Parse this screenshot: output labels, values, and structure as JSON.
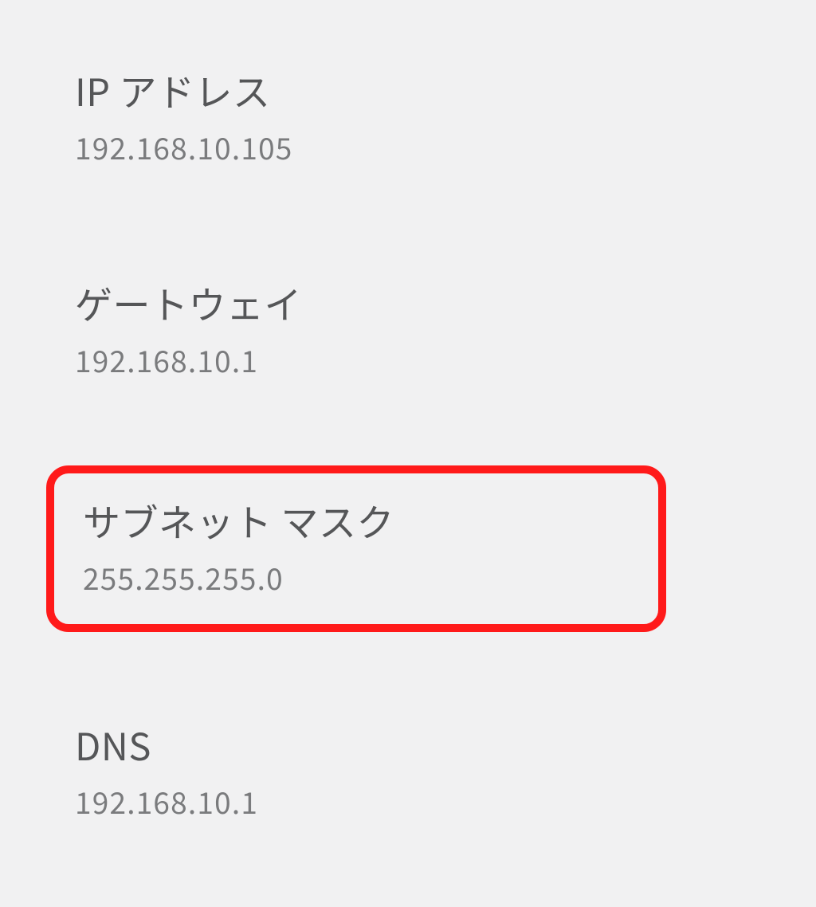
{
  "network": {
    "ip_address": {
      "label": "IP アドレス",
      "value": "192.168.10.105"
    },
    "gateway": {
      "label": "ゲートウェイ",
      "value": "192.168.10.1"
    },
    "subnet_mask": {
      "label": "サブネット マスク",
      "value": "255.255.255.0"
    },
    "dns": {
      "label": "DNS",
      "value": "192.168.10.1"
    }
  }
}
